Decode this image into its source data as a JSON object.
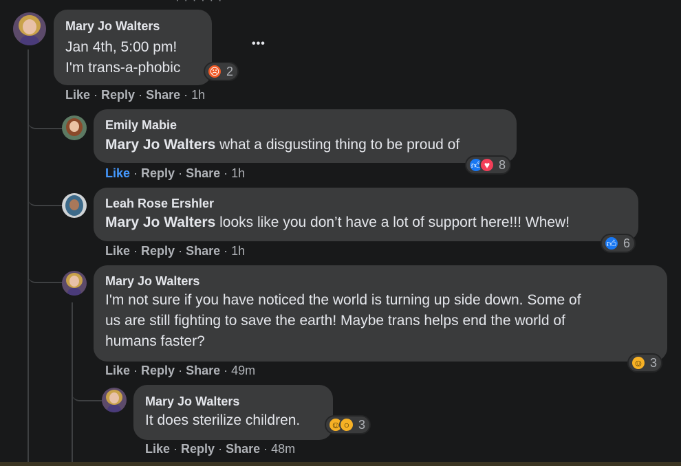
{
  "top_fragment": "· · · · · ·",
  "comments": [
    {
      "author": "Mary Jo Walters",
      "lines": [
        "Jan 4th, 5:00 pm!",
        "I'm trans-a-phobic"
      ],
      "actions": {
        "like": "Like",
        "reply": "Reply",
        "share": "Share",
        "time": "1h"
      },
      "reactions": {
        "icons": [
          "angry-icon"
        ],
        "count": "2"
      }
    },
    {
      "author": "Emily Mabie",
      "mention": "Mary Jo Walters",
      "text": " what a disgusting thing to be proud of",
      "actions": {
        "like": "Like",
        "reply": "Reply",
        "share": "Share",
        "time": "1h"
      },
      "liked": true,
      "reactions": {
        "icons": [
          "like-icon",
          "love-icon"
        ],
        "count": "8"
      }
    },
    {
      "author": "Leah Rose Ershler",
      "mention": "Mary Jo Walters",
      "text": " looks like you don’t have a lot of support here!!! Whew!",
      "actions": {
        "like": "Like",
        "reply": "Reply",
        "share": "Share",
        "time": "1h"
      },
      "reactions": {
        "icons": [
          "like-icon"
        ],
        "count": "6"
      }
    },
    {
      "author": "Mary Jo Walters",
      "lines": [
        "I'm not sure if you have noticed the world is turning up side down. Some of",
        "us are still fighting to save the earth! Maybe trans helps end the world of",
        "humans faster?"
      ],
      "actions": {
        "like": "Like",
        "reply": "Reply",
        "share": "Share",
        "time": "49m"
      },
      "reactions": {
        "icons": [
          "haha-icon"
        ],
        "count": "3"
      }
    },
    {
      "author": "Mary Jo Walters",
      "lines": [
        "It does sterilize children."
      ],
      "actions": {
        "like": "Like",
        "reply": "Reply",
        "share": "Share",
        "time": "48m"
      },
      "reactions": {
        "icons": [
          "haha-icon",
          "wow-icon"
        ],
        "count": "3"
      }
    }
  ],
  "more_options_label": "•••",
  "colors": {
    "background": "#18191a",
    "bubble": "#3a3b3c",
    "liked_blue": "#4599ff",
    "meta": "#b0b3b8"
  }
}
